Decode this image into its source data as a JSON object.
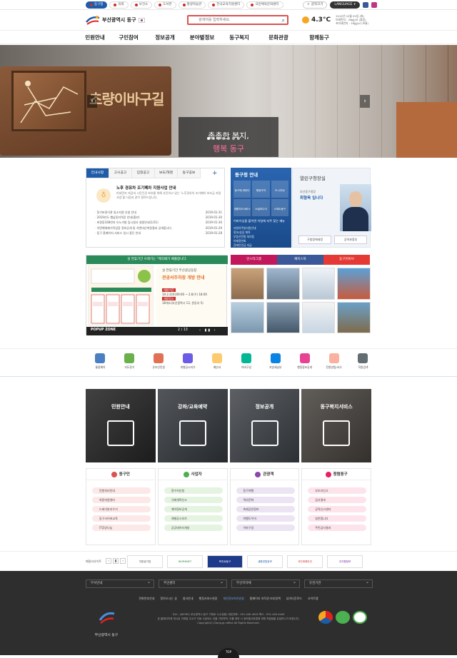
{
  "topbar": {
    "sites": [
      "동구청",
      "의회",
      "보건소",
      "도서관",
      "평생학습관",
      "전국교육지원센터",
      "국민체육문화센터"
    ],
    "language": "LANGUAGE",
    "login": "글자크기",
    "colors": {
      "primary": "#1e5ba8",
      "accent": "#d9534f"
    }
  },
  "header": {
    "logo_text": "부산광역시 동구",
    "search_placeholder": "검색어를 입력하세요.",
    "weather_temp": "4.3°C",
    "weather_info": [
      "2019년 02월 05일 (화)",
      "미세먼지 : 26㎍/㎥ (좋음)",
      "초미세먼지 : 16㎍/㎥ (보통)"
    ]
  },
  "gnb": [
    "민원안내",
    "구민참여",
    "정보공개",
    "분야별정보",
    "동구복지",
    "문화관광",
    "함께동구"
  ],
  "hero": {
    "sign_text": "초량이바구길",
    "caption_line1": "촘촘한 복지,",
    "caption_line2": "행복 동구"
  },
  "notice": {
    "tabs": [
      "언내사항",
      "고시공고",
      "입찰공고",
      "보도/해명",
      "동구공보"
    ],
    "feature_title": "노후 경유차 조기폐차 지원사업 안내",
    "feature_desc": "미세먼지 저감과 시민건강 보호를 위해 추진하고 있는 '노후경유차 조기폐차 보조금 지원 사업'을 다음과 같이 알려드립니다.",
    "items": [
      {
        "title": "찾기보관기관 일소지원 신청 안내",
        "date": "2019-01-31"
      },
      {
        "title": "2019년도 행남동지역강 안내(홍보)",
        "date": "2019-01-30"
      },
      {
        "title": "초량동168번지 오노가발 임시청사 설령안내(1/31)",
        "date": "2019-01-30"
      },
      {
        "title": "석면해체제거작업장 정보공개 및 석면비산측정결과 공개합니다.",
        "date": "2019-01-29"
      },
      {
        "title": "동구 홈페이지 서비스 일시 중단 안내",
        "date": "2019-01-28"
      }
    ]
  },
  "blue_panel": {
    "title": "동구청 안내",
    "grid": [
      "동구에 바란다",
      "행정조직",
      "도시안내",
      "생활지도서비스",
      "소셜미디어",
      "스마트동구"
    ],
    "sub": "이바이싱을 붙이면 이달에 자주 찾는 메뉴",
    "links": [
      "자원의주방자원안내",
      "정보/상담 체육",
      "부동산민원 처리등",
      "의제정연회",
      "장애인연금 지급"
    ]
  },
  "mayor": {
    "title": "열린구청장실",
    "line1": "부산동구청장",
    "line2": "최형욱 입니다",
    "btn1": "구청장에세랑",
    "btn2": "공약과정부"
  },
  "popup": {
    "banner": "설 연휴기간 쓰레기는 \"제각때가 배출합니다.",
    "right_t1": "설 연휴기간 부산광공동창",
    "right_t2": "관공서주차장 개방 안내",
    "detail1": "개방기간",
    "detail2": "19.2.2(토)09:00 ~ 2.6(수) 18:00",
    "detail3": "개방장소",
    "detail4": "18개소(부산광역시 13, 관공서 5)",
    "zone_label": "POPUP ZONE",
    "page": "2 / 13",
    "controls": "‹ ▮▮ ›"
  },
  "sns": {
    "tabs": [
      "인스타그램",
      "페이스북",
      "동구유튜브"
    ],
    "tab_colors": [
      "#c2185b",
      "#3b5998",
      "#e53935"
    ]
  },
  "quick": [
    "통합예약",
    "지도찾기",
    "온라인민원",
    "개별공시지가",
    "예산서",
    "이바구길",
    "지방세납부",
    "행정정보공개",
    "민원양법/서식",
    "직원검색"
  ],
  "cards": [
    "민원안내",
    "강좌/교육예약",
    "정보공개",
    "동구복지서비스"
  ],
  "categories": [
    {
      "title": "동구민",
      "color": "#d9534f",
      "bg": "#fde8e8",
      "items": [
        "민원처리안내",
        "희망지원센터",
        "드레기분리수거",
        "동구사이버교육",
        "IT휴양나눔"
      ]
    },
    {
      "title": "사업자",
      "color": "#4caf50",
      "bg": "#e5f4e0",
      "items": [
        "정수허신청",
        "규제개혁신고",
        "계약정보공개",
        "개별공시지가",
        "공공데이터개방"
      ]
    },
    {
      "title": "관광객",
      "color": "#8e44ad",
      "bg": "#ece4f3",
      "items": [
        "동구여행",
        "역사문화",
        "축제공연정보",
        "여행도우미",
        "이바구길"
      ]
    },
    {
      "title": "청렴동구",
      "color": "#e91e63",
      "bg": "#fde4ea",
      "items": [
        "부조리신고",
        "감사결과",
        "공직신고센터",
        "칭찬합니다",
        "주민감사결과"
      ]
    }
  ],
  "family": {
    "label": "패밀리사이트",
    "logos": [
      "지방공기업",
      "WORKNET",
      "복지로동구",
      "생활방법정보",
      "국민재해안전",
      "주자원정보"
    ]
  },
  "footer": {
    "selects": [
      "부서안내",
      "주민센터",
      "부산지자체",
      "유관기관"
    ],
    "menu": [
      "전화번호안내",
      "찾아오시는 길",
      "청사안내",
      "행정서비스헌장",
      "개인정보처리방침",
      "홈페이지 저작권 보호정책",
      "뷰어다운로드",
      "사이트맵"
    ],
    "address": "주소 : (48785) 부산광역시 동구 구청로 1(수정동)  대표전화 : 051-440-4000  팩스 : 051-440-4444",
    "notice": "본 홈페이지에 게시된 이메일 주소가 자동 수집되는 것을 거부하며, 이를 위반 시 정보통신망법에 의해 처벌됨을 유념하시기 바랍니다.",
    "copyright": "Copyright(C) Dong-gu office All Rights Reserved.",
    "name": "부산광역시 동구",
    "top": "TOP"
  }
}
